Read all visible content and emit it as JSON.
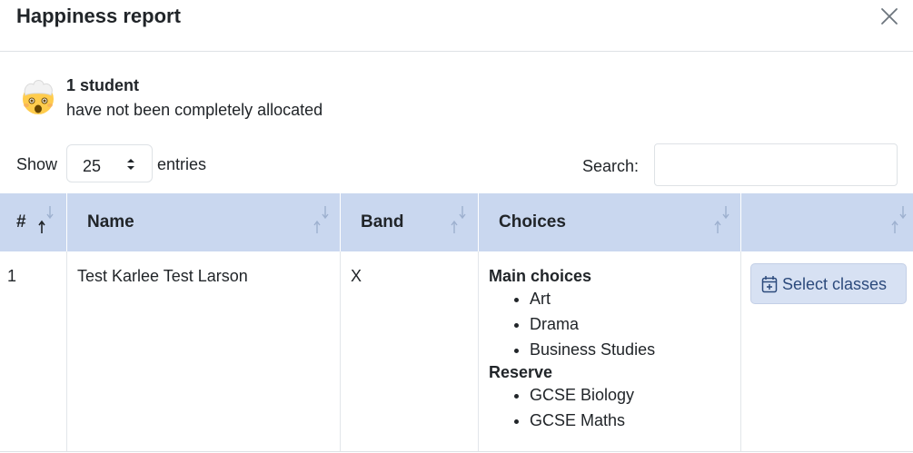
{
  "modal": {
    "title": "Happiness report",
    "close_icon": "close-icon"
  },
  "alert": {
    "icon": "exploding-head-emoji",
    "count": "1 student",
    "message": "have not been completely allocated"
  },
  "length": {
    "show_label": "Show",
    "value": "25",
    "entries_label": "entries"
  },
  "search": {
    "label": "Search:",
    "value": ""
  },
  "table": {
    "header_color": "#c9d7ef",
    "columns": [
      {
        "label": "#",
        "sort": "ascending"
      },
      {
        "label": "Name",
        "sort": "none"
      },
      {
        "label": "Band",
        "sort": "none"
      },
      {
        "label": "Choices",
        "sort": "none"
      },
      {
        "label": "",
        "sort": "none"
      }
    ],
    "rows": [
      {
        "number": "1",
        "name": "Test Karlee Test Larson",
        "band": "X",
        "choices": {
          "main_label": "Main choices",
          "main": [
            "Art",
            "Drama",
            "Business Studies"
          ],
          "reserve_label": "Reserve",
          "reserve": [
            "GCSE Biology",
            "GCSE Maths"
          ]
        },
        "action": {
          "label": "Select classes",
          "icon": "calendar-plus-icon"
        }
      }
    ]
  }
}
